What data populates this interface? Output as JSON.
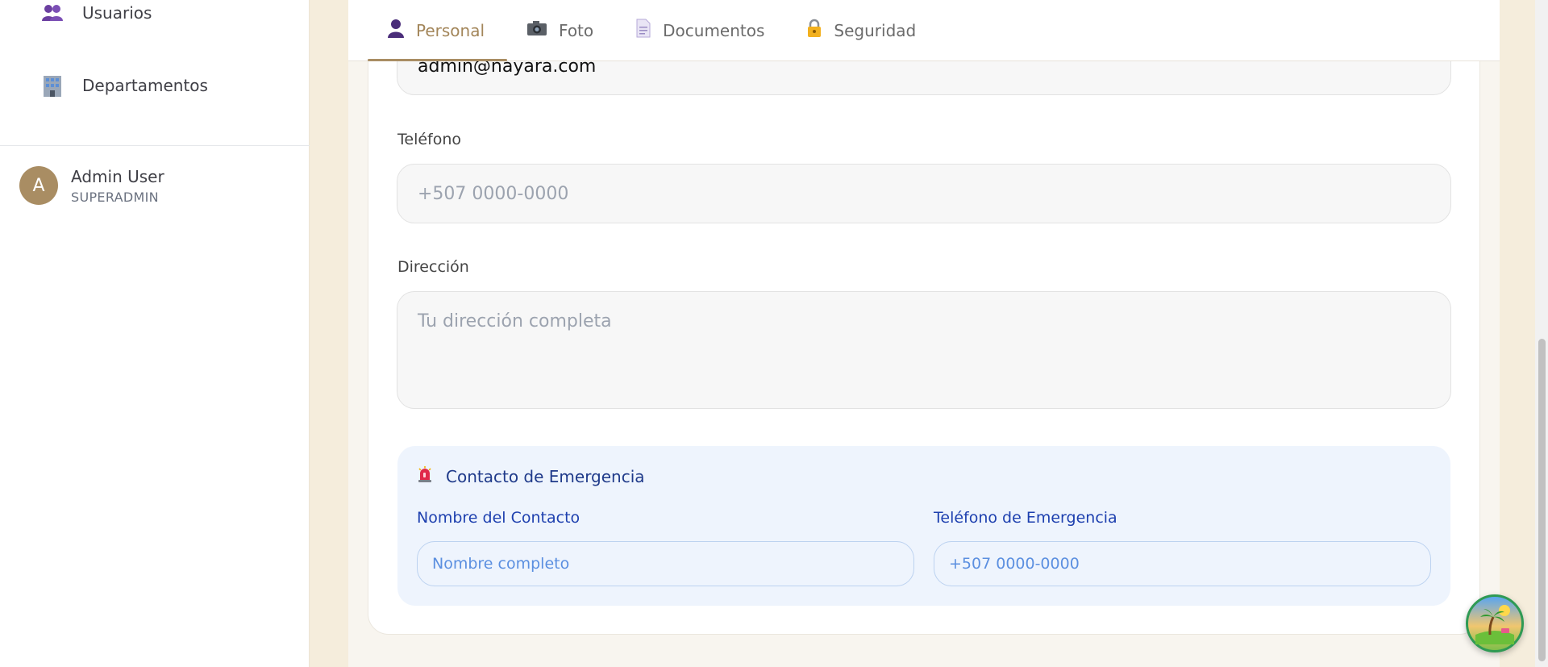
{
  "sidebar": {
    "items": [
      {
        "label": "Usuarios",
        "icon": "users-icon"
      },
      {
        "label": "Departamentos",
        "icon": "building-icon"
      }
    ],
    "user": {
      "initial": "A",
      "name": "Admin User",
      "role": "SUPERADMIN"
    }
  },
  "tabs": [
    {
      "label": "Personal",
      "icon": "person-icon",
      "active": true
    },
    {
      "label": "Foto",
      "icon": "camera-icon",
      "active": false
    },
    {
      "label": "Documentos",
      "icon": "document-icon",
      "active": false
    },
    {
      "label": "Seguridad",
      "icon": "lock-icon",
      "active": false
    }
  ],
  "form": {
    "email": {
      "value": "admin@nayara.com"
    },
    "phone": {
      "label": "Teléfono",
      "placeholder": "+507 0000-0000",
      "value": ""
    },
    "address": {
      "label": "Dirección",
      "placeholder": "Tu dirección completa",
      "value": ""
    }
  },
  "emergency": {
    "title": "Contacto de Emergencia",
    "icon": "siren-icon",
    "contact_name": {
      "label": "Nombre del Contacto",
      "placeholder": "Nombre completo"
    },
    "contact_phone": {
      "label": "Teléfono de Emergencia",
      "placeholder": "+507 0000-0000"
    }
  },
  "fab": {
    "icon": "palm-island-icon"
  },
  "colors": {
    "accent": "#a98d63",
    "page_bg": "#f5eddc",
    "emergency_bg": "#eef4fd",
    "emergency_text": "#1e40af"
  }
}
